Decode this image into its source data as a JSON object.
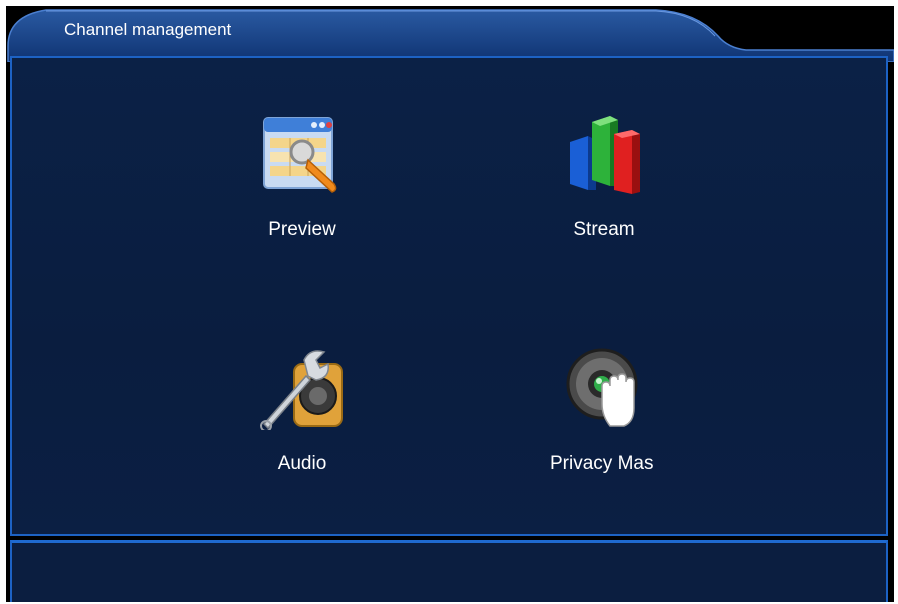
{
  "window": {
    "title": "Channel management"
  },
  "menu": {
    "items": [
      {
        "label": "Preview",
        "icon": "preview-icon"
      },
      {
        "label": "Stream",
        "icon": "stream-icon"
      },
      {
        "label": "Audio",
        "icon": "audio-icon"
      },
      {
        "label": "Privacy Mas",
        "icon": "privacy-mask-icon"
      }
    ]
  },
  "colors": {
    "panel_background": "#0a1d3f",
    "panel_border": "#1d62c4",
    "tab_background": "#123a78",
    "text": "#ffffff"
  }
}
